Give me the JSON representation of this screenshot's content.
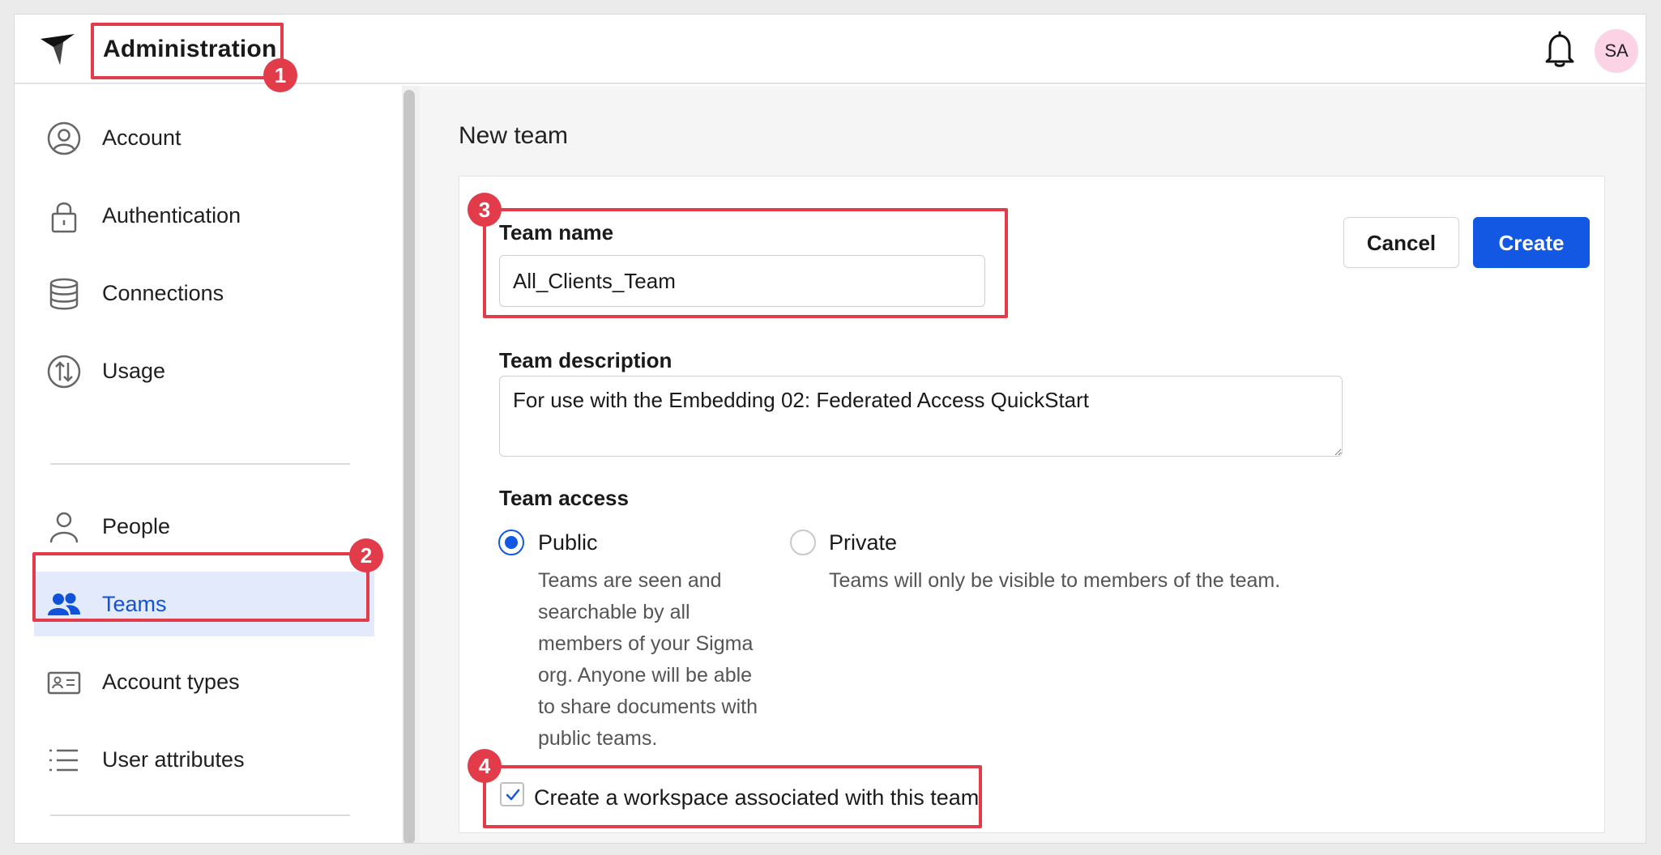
{
  "header": {
    "app_title": "Administration",
    "avatar_initials": "SA",
    "logo_icon": "sigma-bird-logo-icon",
    "notification_icon": "bell-icon"
  },
  "sidebar": {
    "items": [
      {
        "label": "Account",
        "icon": "user-circle-icon",
        "active": false
      },
      {
        "label": "Authentication",
        "icon": "lock-icon",
        "active": false
      },
      {
        "label": "Connections",
        "icon": "database-icon",
        "active": false
      },
      {
        "label": "Usage",
        "icon": "usage-arrows-icon",
        "active": false
      },
      {
        "label": "People",
        "icon": "person-icon",
        "active": false
      },
      {
        "label": "Teams",
        "icon": "teams-icon",
        "active": true
      },
      {
        "label": "Account types",
        "icon": "id-card-icon",
        "active": false
      },
      {
        "label": "User attributes",
        "icon": "list-icon",
        "active": false
      }
    ]
  },
  "main": {
    "page_title": "New team",
    "team_name": {
      "label": "Team name",
      "value": "All_Clients_Team"
    },
    "team_description": {
      "label": "Team description",
      "value": "For use with the Embedding 02: Federated Access QuickStart"
    },
    "team_access": {
      "label": "Team access",
      "options": [
        {
          "label": "Public",
          "selected": true,
          "description": [
            "Teams are seen and",
            "searchable by all",
            "members of your Sigma",
            "org. Anyone will be able",
            "to share documents with",
            "public teams."
          ]
        },
        {
          "label": "Private",
          "selected": false,
          "description": [
            "Teams will only be visible to members of the team."
          ]
        }
      ]
    },
    "workspace_checkbox": {
      "label": "Create a workspace associated with this team",
      "checked": true
    },
    "buttons": {
      "cancel": "Cancel",
      "create": "Create"
    }
  },
  "annotations": {
    "badges": [
      "1",
      "2",
      "3",
      "4"
    ],
    "color": "#e23b4a"
  },
  "colors": {
    "accent": "#1258e2",
    "active_nav_bg": "#e3eafb",
    "avatar_bg": "#fbd3e4"
  }
}
